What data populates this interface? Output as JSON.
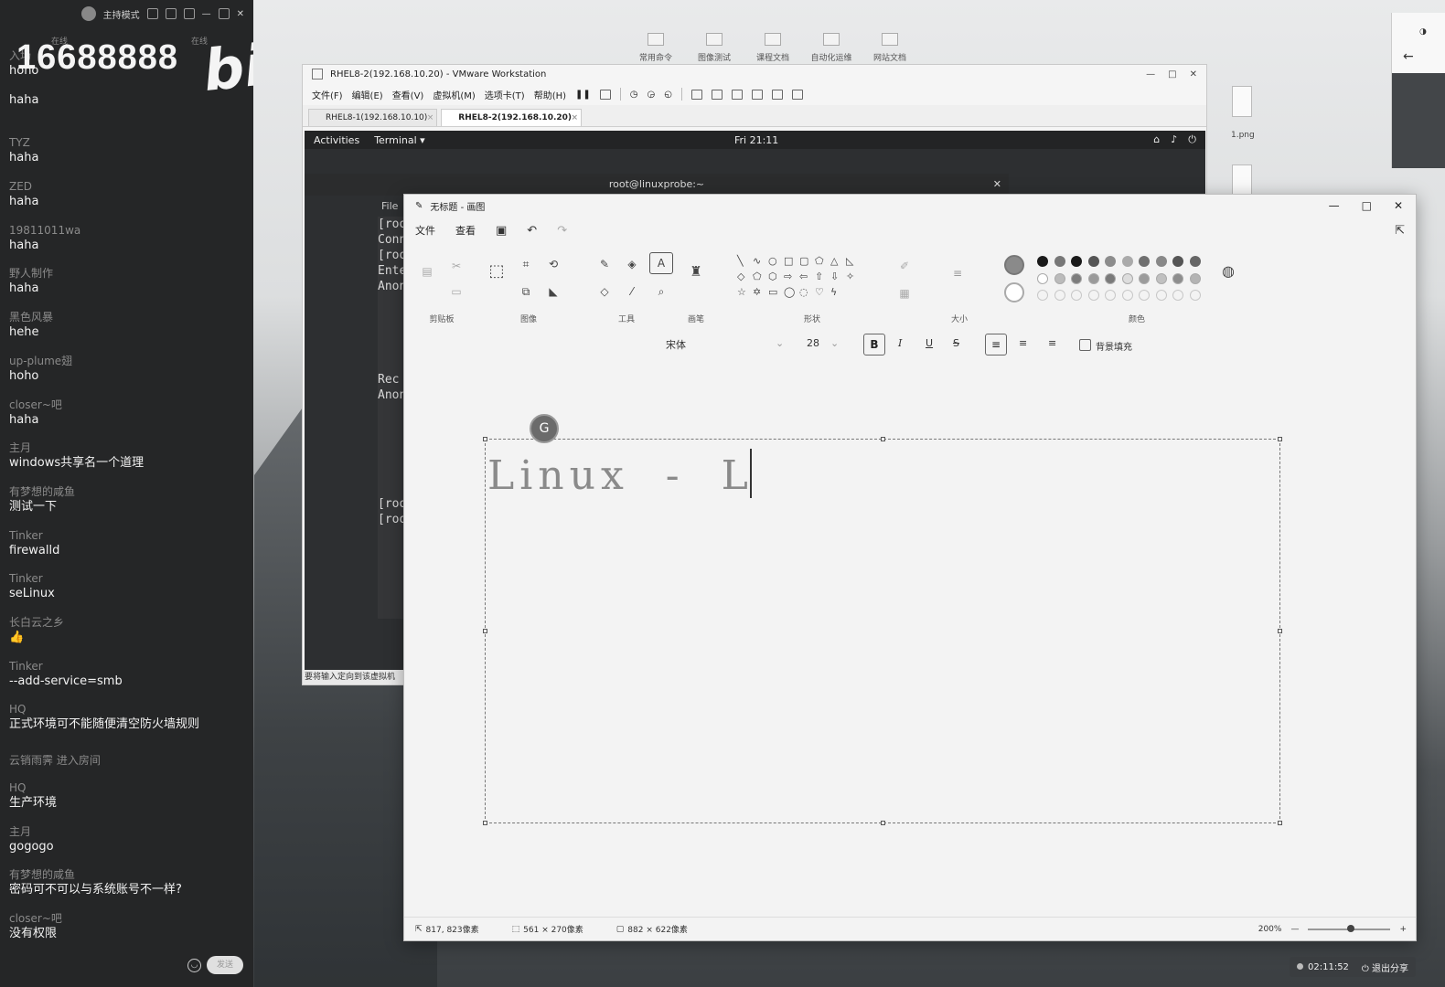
{
  "chat": {
    "header": {
      "mode_label": "主持模式"
    },
    "tabs": [
      "在线",
      "在线"
    ],
    "watermark": "16688888",
    "logo_text": "bilibili",
    "messages": [
      {
        "user": "",
        "text": "haha"
      },
      {
        "user": "TYZ",
        "text": "haha"
      },
      {
        "user": "ZED",
        "text": "haha"
      },
      {
        "user": "19811011wa",
        "text": "haha"
      },
      {
        "user": "野人制作",
        "text": "haha"
      },
      {
        "user": "黑色风暴",
        "text": "hehe"
      },
      {
        "user": "up-plume翅",
        "text": "hoho"
      },
      {
        "user": "closer~吧",
        "text": "haha"
      },
      {
        "user": "主月",
        "text": "windows共享名一个道理"
      },
      {
        "user": "有梦想的咸鱼",
        "text": "测试一下"
      },
      {
        "user": "Tinker",
        "text": "firewalld"
      },
      {
        "user": "Tinker",
        "text": "seLinux"
      },
      {
        "user": "长白云之乡",
        "text": "👍"
      },
      {
        "user": "Tinker",
        "text": "--add-service=smb"
      },
      {
        "user": "HQ",
        "text": "正式环境可不能随便清空防火墙规则"
      },
      {
        "user": "云销雨霁 进入房间",
        "text": ""
      },
      {
        "user": "HQ",
        "text": "生产环境"
      },
      {
        "user": "主月",
        "text": "gogogo"
      },
      {
        "user": "有梦想的咸鱼",
        "text": "密码可不可以与系统账号不一样?"
      },
      {
        "user": "closer~吧",
        "text": "没有权限"
      }
    ],
    "top_message": {
      "user": "入场",
      "text": "hoho"
    },
    "send_label": "发送"
  },
  "desktop": {
    "icons": [
      "常用命令",
      "图像测试",
      "课程文档",
      "自动化运维",
      "网站文档"
    ],
    "file_label": "1.png"
  },
  "vmware": {
    "title": "RHEL8-2(192.168.10.20) - VMware Workstation",
    "menu": [
      "文件(F)",
      "编辑(E)",
      "查看(V)",
      "虚拟机(M)",
      "选项卡(T)",
      "帮助(H)"
    ],
    "tabs": [
      {
        "label": "RHEL8-1(192.168.10.10)",
        "active": false
      },
      {
        "label": "RHEL8-2(192.168.10.20)",
        "active": true
      }
    ],
    "status_hint": "要将输入定向到该虚拟机"
  },
  "gnome": {
    "activities": "Activities",
    "app_menu": "Terminal ▾",
    "clock": "Fri 21:11",
    "terminal_title": "root@linuxprobe:~",
    "file_menu": "File",
    "lines": [
      "[roo",
      "Conn",
      "[roo",
      "Ente",
      "Anon",
      "",
      "",
      "",
      "",
      "",
      "Rec",
      "Anon",
      "",
      "",
      "",
      "",
      "",
      "",
      "[roo",
      "[roo"
    ]
  },
  "paint": {
    "title": "无标题 - 画图",
    "menu": [
      "文件",
      "查看"
    ],
    "groups": {
      "clipboard": "剪贴板",
      "image": "图像",
      "tools": "工具",
      "brushes": "画笔",
      "shapes": "形状",
      "size": "大小",
      "colors": "颜色"
    },
    "font_name": "宋体",
    "font_size": "28",
    "bg_fill_label": "背景填充",
    "canvas_text": "Linux  -  L",
    "cursor_pos": "817, 823像素",
    "selection_size": "561 × 270像素",
    "canvas_size": "882 × 622像素",
    "zoom_label": "200%",
    "zoom_fraction": 0.5,
    "palette": [
      "#1a1a1a",
      "#777777",
      "#1a1a1a",
      "#555555",
      "#8c8c8c",
      "#aaaaaa",
      "#6f6f6f",
      "#888888",
      "#555555",
      "#666666",
      "#ffffff",
      "#bbbbbb",
      "#7d7d7d",
      "#9a9a9a",
      "#7a7a7a",
      "#dddddd",
      "#9b9b9b",
      "#c0c0c0",
      "#8d8d8d",
      "#b4b4b4"
    ],
    "primary_color": "#8a8a8a",
    "secondary_color": "#ffffff"
  },
  "tray": {
    "timer": "02:11:52",
    "exit_share": "退出分享"
  }
}
